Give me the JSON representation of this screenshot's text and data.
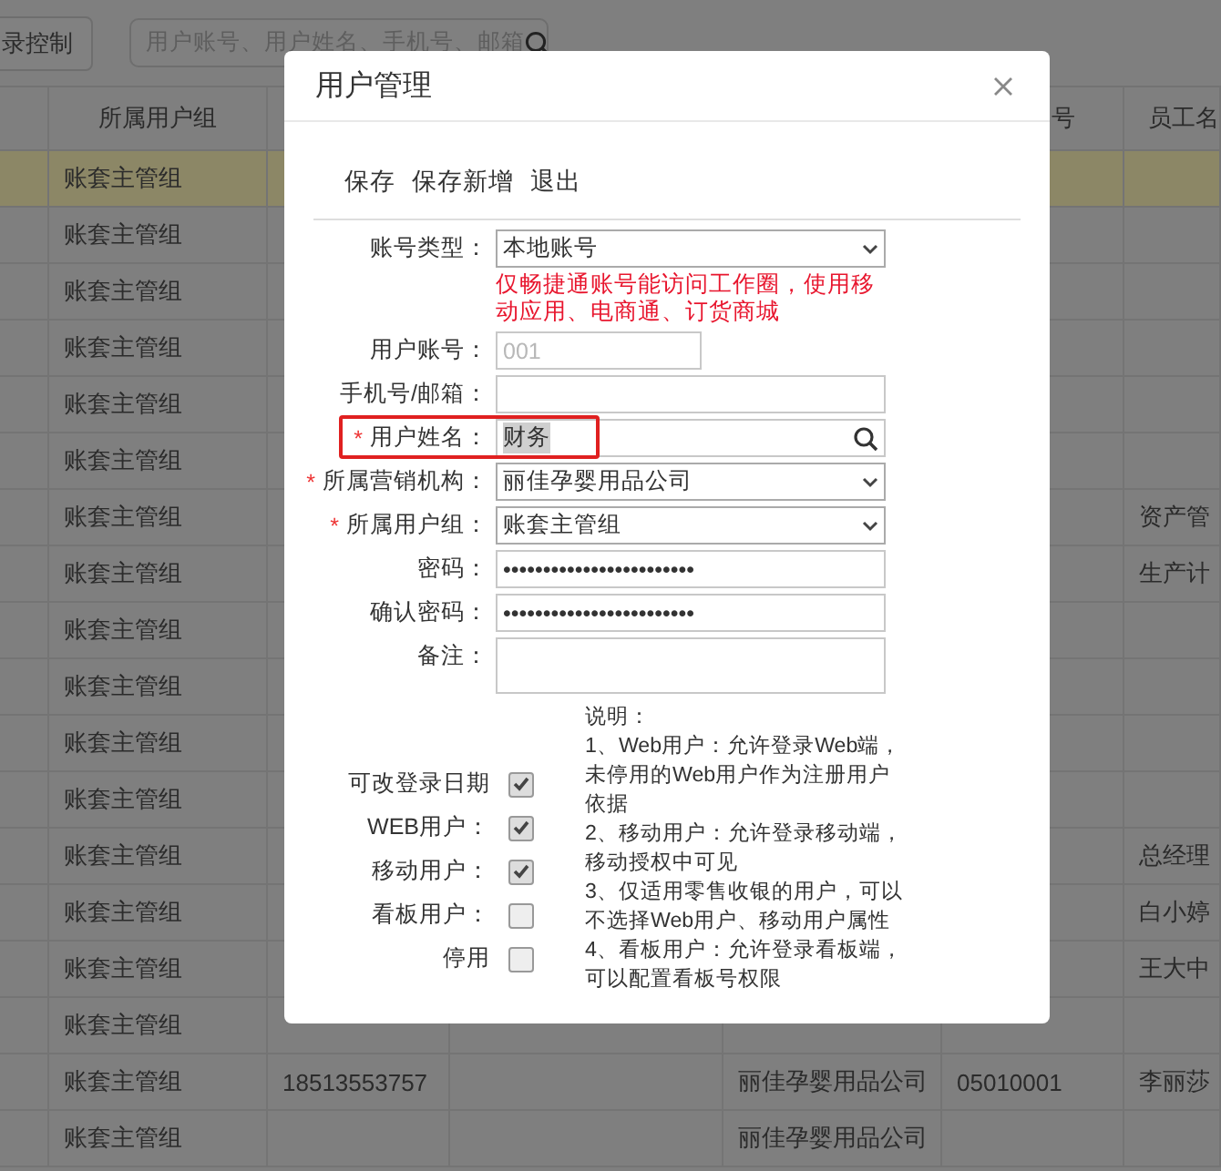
{
  "toolbar": {
    "button": "录控制",
    "search": {
      "placeholder": "用户账号、用户姓名、手机号、邮箱"
    }
  },
  "table": {
    "header": {
      "column_1": "所属用户组",
      "column_5": "号",
      "column_6": "员工名"
    },
    "rows": [
      {
        "selected": true,
        "column_1": "账套主管组"
      },
      {
        "selected": false,
        "column_1": "账套主管组"
      },
      {
        "selected": false,
        "column_1": "账套主管组"
      },
      {
        "selected": false,
        "column_1": "账套主管组"
      },
      {
        "selected": false,
        "column_1": "账套主管组"
      },
      {
        "selected": false,
        "column_1": "账套主管组"
      },
      {
        "selected": false,
        "column_1": "账套主管组",
        "column_6": "资产管"
      },
      {
        "selected": false,
        "column_1": "账套主管组",
        "column_6": "生产计"
      },
      {
        "selected": false,
        "column_1": "账套主管组"
      },
      {
        "selected": false,
        "column_1": "账套主管组"
      },
      {
        "selected": false,
        "column_1": "账套主管组"
      },
      {
        "selected": false,
        "column_1": "账套主管组"
      },
      {
        "selected": false,
        "column_1": "账套主管组",
        "column_6": "总经理"
      },
      {
        "selected": false,
        "column_1": "账套主管组",
        "column_6": "白小婷"
      },
      {
        "selected": false,
        "column_1": "账套主管组",
        "column_6": "王大中"
      },
      {
        "selected": false,
        "column_1": "账套主管组"
      },
      {
        "selected": false,
        "column_1": "账套主管组",
        "column_2": "18513553757",
        "column_4": "丽佳孕婴用品公司",
        "column_5": "05010001",
        "column_6": "李丽莎"
      },
      {
        "selected": false,
        "column_1": "账套主管组",
        "column_4": "丽佳孕婴用品公司"
      }
    ]
  },
  "dialog": {
    "title": "用户管理",
    "actions": [
      "保存",
      "保存新增",
      "退出"
    ],
    "fields": [
      {
        "kind": "select",
        "label": "账号类型：",
        "value": "本地账号",
        "note": "仅畅捷通账号能访问工作圈，使用移动应用、电商通、订货商城"
      },
      {
        "kind": "short",
        "label": "用户账号：",
        "value": "001",
        "disabled": true
      },
      {
        "kind": "text",
        "label": "手机号/邮箱："
      },
      {
        "kind": "search",
        "label": "用户姓名：",
        "required_mark": "*",
        "value": "财务",
        "value_selected": true,
        "annotated": true
      },
      {
        "kind": "select",
        "label": "所属营销机构：",
        "required_mark": "*",
        "value": "丽佳孕婴用品公司"
      },
      {
        "kind": "select",
        "label": "所属用户组：",
        "required_mark": "*",
        "value": "账套主管组"
      },
      {
        "kind": "text",
        "label": "密码：",
        "value": "••••••••••••••••••••••••"
      },
      {
        "kind": "text",
        "label": "确认密码：",
        "value": "••••••••••••••••••••••••"
      },
      {
        "kind": "textarea",
        "label": "备注："
      }
    ],
    "checkboxes": [
      {
        "label": "可改登录日期",
        "checked": true
      },
      {
        "label": "WEB用户：",
        "checked": true
      },
      {
        "label": "移动用户：",
        "checked": true
      },
      {
        "label": "看板用户：",
        "checked": false
      },
      {
        "label": "停用",
        "checked": false
      }
    ],
    "notes": [
      "说明：",
      "1、Web用户：允许登录Web端，未停用的Web用户作为注册用户依据",
      "2、移动用户：允许登录移动端，移动授权中可见",
      "3、仅适用零售收银的用户，可以不选择Web用户、移动用户属性",
      "4、看板用户：允许登录看板端，可以配置看板号权限"
    ]
  }
}
